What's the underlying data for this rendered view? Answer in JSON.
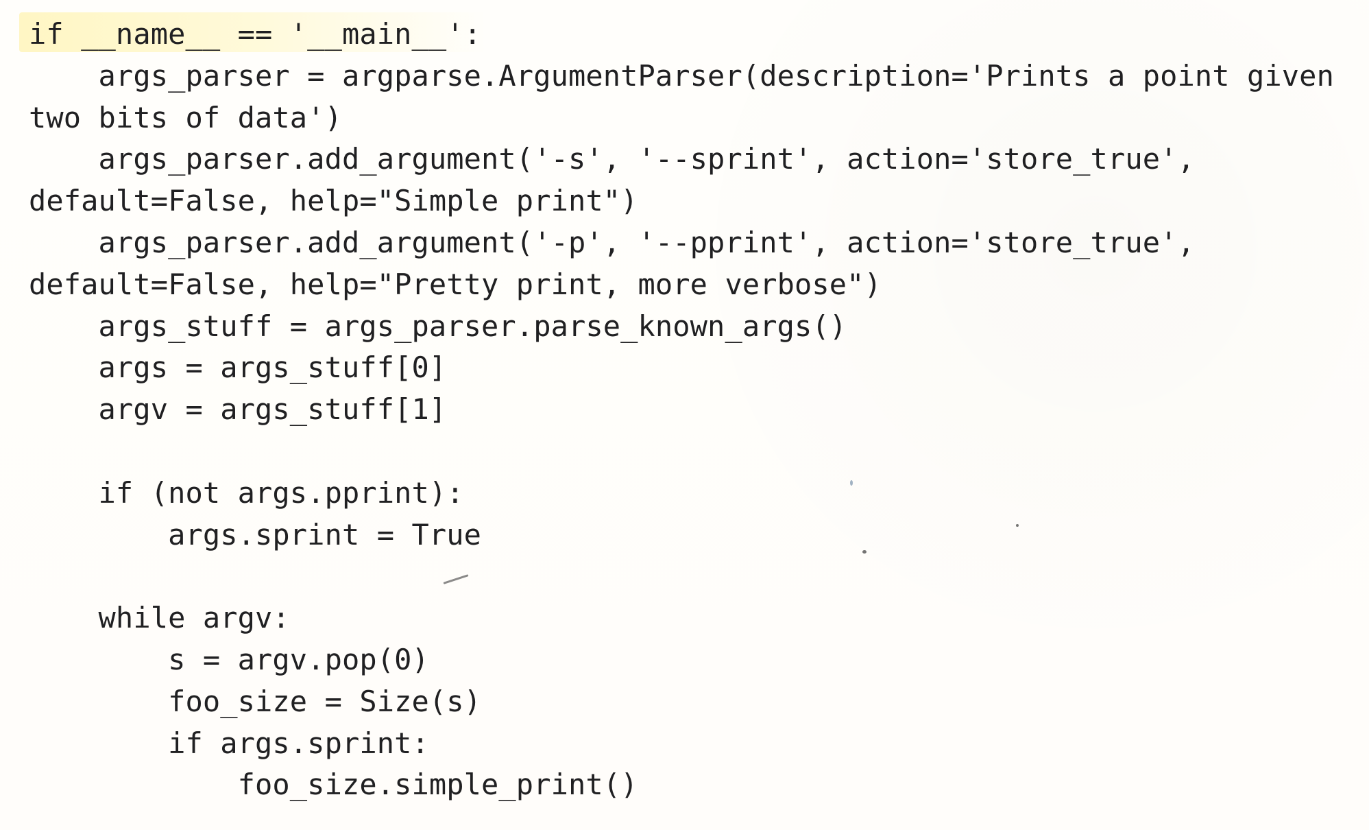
{
  "document": {
    "code_lines": [
      "if __name__ == '__main__':",
      "    args_parser = argparse.ArgumentParser(description='Prints a point given",
      "two bits of data')",
      "    args_parser.add_argument('-s', '--sprint', action='store_true',",
      "default=False, help=\"Simple print\")",
      "    args_parser.add_argument('-p', '--pprint', action='store_true',",
      "default=False, help=\"Pretty print, more verbose\")",
      "    args_stuff = args_parser.parse_known_args()",
      "    args = args_stuff[0]",
      "    argv = args_stuff[1]",
      "",
      "    if (not args.pprint):",
      "        args.sprint = True",
      "",
      "    while argv:",
      "        s = argv.pop(0)",
      "        foo_size = Size(s)",
      "        if args.sprint:",
      "            foo_size.simple_print()"
    ]
  },
  "colors": {
    "paper": "#fffefb",
    "text": "#202022",
    "highlight": "#fff4b4"
  }
}
